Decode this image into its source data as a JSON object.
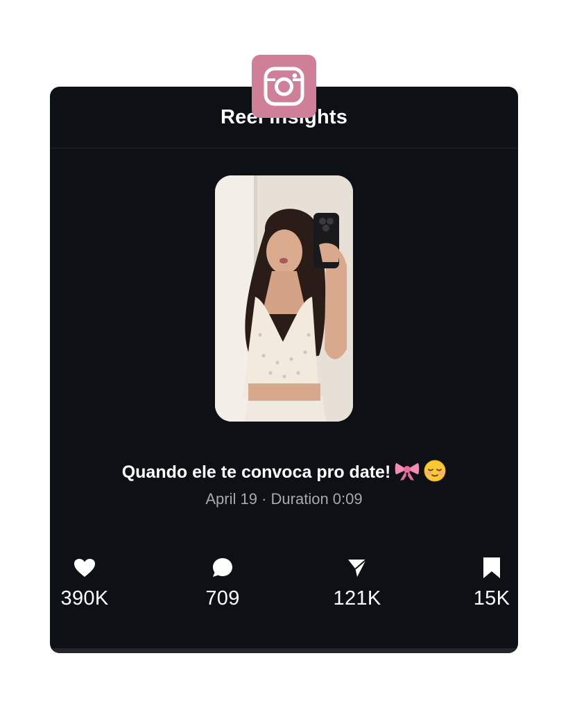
{
  "header": {
    "title": "Reel insights",
    "badge_icon": "instagram-icon",
    "badge_color": "#cf7f98"
  },
  "reel": {
    "thumbnail_icon": "reel-thumbnail-image",
    "caption": "Quando ele te convoca pro date!",
    "caption_emojis": [
      "ribbon-emoji",
      "relieved-face-emoji"
    ],
    "meta": "April 19 · Duration 0:09"
  },
  "stats": [
    {
      "icon": "heart-icon",
      "label": "likes",
      "value": "390K"
    },
    {
      "icon": "comment-icon",
      "label": "comments",
      "value": "709"
    },
    {
      "icon": "share-icon",
      "label": "shares",
      "value": "121K"
    },
    {
      "icon": "bookmark-icon",
      "label": "saves",
      "value": "15K"
    }
  ],
  "colors": {
    "card_background": "#0d1015",
    "text_primary": "#ffffff",
    "text_secondary": "#a6a9ae"
  }
}
